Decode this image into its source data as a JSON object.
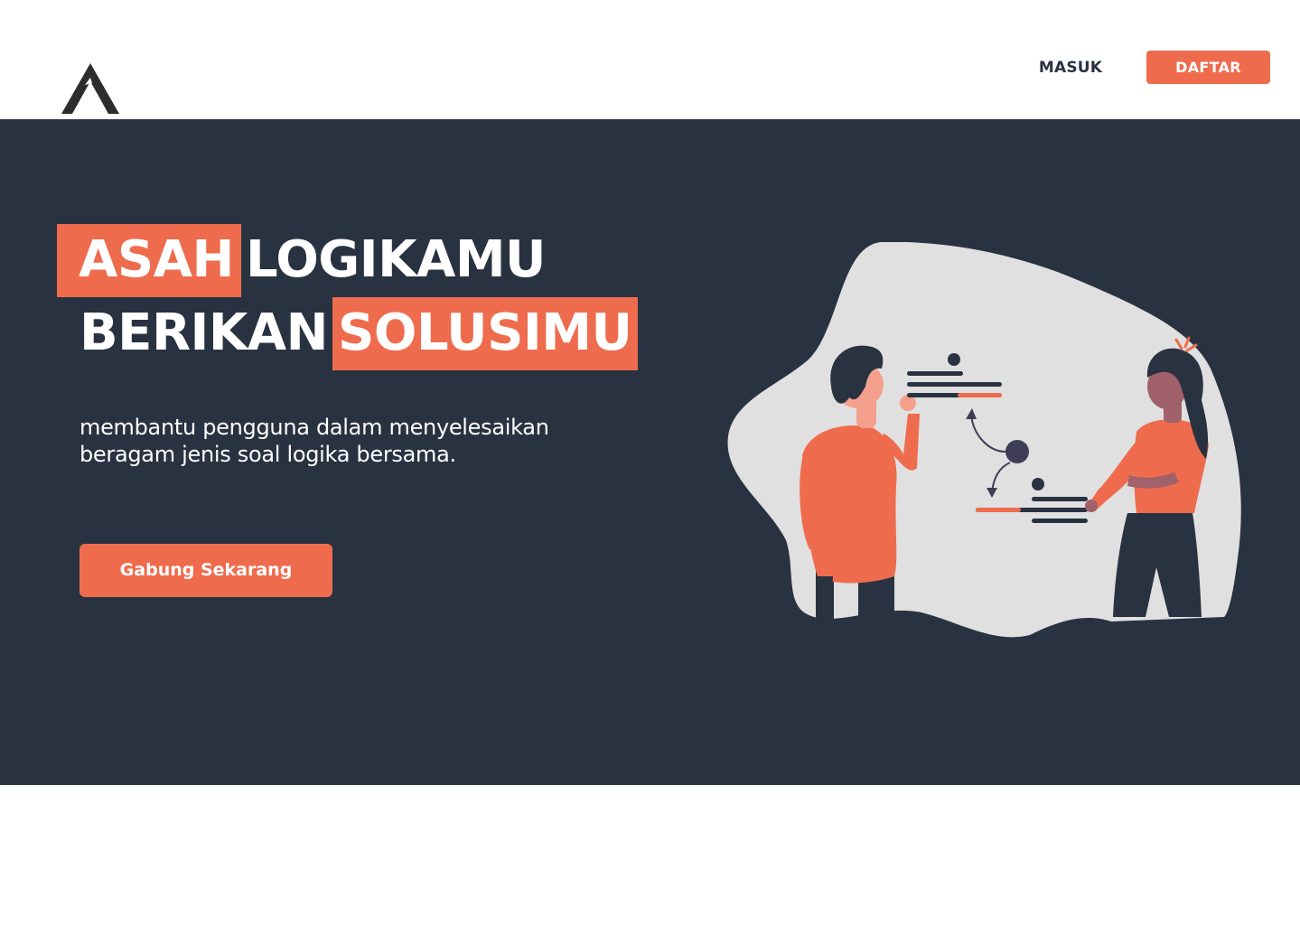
{
  "header": {
    "logo_icon": "mountain-logo-icon",
    "login_label": "MASUK",
    "register_label": "DAFTAR"
  },
  "hero": {
    "headline_word_1": "ASAH",
    "headline_word_2": "LOGIKAMU",
    "headline_word_3": "BERIKAN",
    "headline_word_4": "SOLUSIMU",
    "subtitle_line_1": "membantu pengguna dalam menyelesaikan",
    "subtitle_line_2": "beragam jenis soal logika bersama.",
    "cta_label": "Gabung Sekarang",
    "illustration": "two-people-exchanging-data-illustration"
  },
  "colors": {
    "accent": "#ee6c4d",
    "dark": "#293241",
    "blob": "#e0e0e0",
    "white": "#ffffff"
  }
}
